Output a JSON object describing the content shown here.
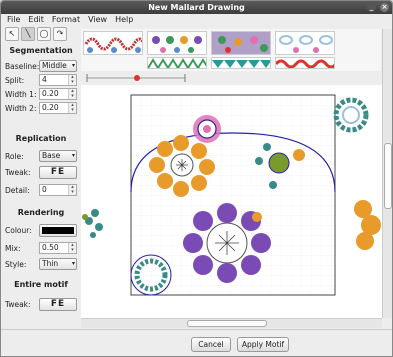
{
  "window": {
    "title": "New Mallard Drawing",
    "minimize": "_",
    "close": "×"
  },
  "menu": [
    "File",
    "Edit",
    "Format",
    "View",
    "Help"
  ],
  "tools": [
    "↖",
    "╲",
    "◯",
    "↷"
  ],
  "segmentation": {
    "heading": "Segmentation",
    "baseline_label": "Baseline:",
    "baseline_value": "Middle",
    "split_label": "Split:",
    "split_value": "4",
    "width1_label": "Width 1:",
    "width1_value": "0.20",
    "width2_label": "Width 2:",
    "width2_value": "0.20"
  },
  "replication": {
    "heading": "Replication",
    "role_label": "Role:",
    "role_value": "Base",
    "tweak_label": "Tweak:",
    "tweak_value": "FE",
    "detail_label": "Detail:",
    "detail_value": "0"
  },
  "rendering": {
    "heading": "Rendering",
    "colour_label": "Colour:",
    "colour_value": "#000000",
    "mix_label": "Mix:",
    "mix_value": "0.50",
    "style_label": "Style:",
    "style_value": "Thin"
  },
  "entire_motif": {
    "heading": "Entire motif",
    "tweak_label": "Tweak:",
    "tweak_value": "FE"
  },
  "buttons": {
    "cancel": "Cancel",
    "apply": "Apply Motif"
  },
  "colors": {
    "orange": "#e89a2a",
    "purple": "#7b4bb5",
    "blue": "#2222aa",
    "teal": "#3a8a8a",
    "pink": "#e070b0",
    "olive": "#7a9a2a",
    "red": "#e03030"
  }
}
